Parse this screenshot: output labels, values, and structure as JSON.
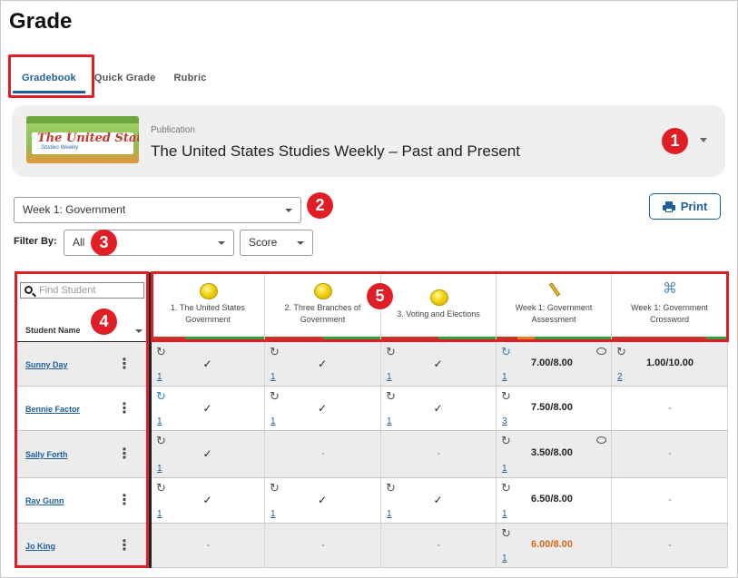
{
  "page": {
    "title": "Grade"
  },
  "tabs": [
    {
      "label": "Gradebook",
      "active": true
    },
    {
      "label": "Quick Grade",
      "active": false
    },
    {
      "label": "Rubric",
      "active": false
    }
  ],
  "publication": {
    "label": "Publication",
    "name": "The United States Studies Weekly – Past and Present",
    "cover_title": "The United States",
    "cover_subtitle": "Studies Weekly"
  },
  "week_select": {
    "value": "Week 1: Government"
  },
  "print_label": "Print",
  "filter": {
    "label": "Filter By:",
    "value": "All",
    "score_value": "Score"
  },
  "search": {
    "placeholder": "Find Student"
  },
  "student_header": "Student Name",
  "badges": [
    "1",
    "2",
    "3",
    "4",
    "5"
  ],
  "columns": [
    {
      "line1": "1. The United States",
      "line2": "Government",
      "icon": "coin-icon"
    },
    {
      "line1": "2. Three Branches of",
      "line2": "Government",
      "icon": "coin-icon"
    },
    {
      "line1": "3. Voting and Elections",
      "line2": "",
      "icon": "coin-icon"
    },
    {
      "line1": "Week 1: Government",
      "line2": "Assessment",
      "icon": "pencil-icon"
    },
    {
      "line1": "Week 1: Government",
      "line2": "Crossword",
      "icon": "crossword-icon"
    }
  ],
  "students": [
    {
      "name": "Sunny Day",
      "cells": [
        {
          "refresh": "gray",
          "mark": "✓",
          "attempt": "1"
        },
        {
          "refresh": "gray",
          "mark": "✓",
          "attempt": "1"
        },
        {
          "refresh": "gray",
          "mark": "✓",
          "attempt": "1"
        },
        {
          "refresh": "blue",
          "score": "7.00/8.00",
          "attempt": "1",
          "comment": true
        },
        {
          "refresh": "gray",
          "score": "1.00/10.00",
          "attempt": "2"
        }
      ]
    },
    {
      "name": "Bennie Factor",
      "cells": [
        {
          "refresh": "blue",
          "mark": "✓",
          "attempt": "1"
        },
        {
          "refresh": "gray",
          "mark": "✓",
          "attempt": "1"
        },
        {
          "refresh": "gray",
          "mark": "✓",
          "attempt": "1"
        },
        {
          "refresh": "gray",
          "score": "7.50/8.00",
          "attempt": "3"
        },
        {
          "dash": "-"
        }
      ]
    },
    {
      "name": "Sally Forth",
      "cells": [
        {
          "refresh": "gray",
          "mark": "✓",
          "attempt": "1"
        },
        {
          "dash": "-"
        },
        {
          "dash": "-"
        },
        {
          "refresh": "gray",
          "score": "3.50/8.00",
          "attempt": "1",
          "comment": true
        },
        {
          "dash": "-"
        }
      ]
    },
    {
      "name": "Ray Gunn",
      "cells": [
        {
          "refresh": "gray",
          "mark": "✓",
          "attempt": "1"
        },
        {
          "refresh": "gray",
          "mark": "✓",
          "attempt": "1"
        },
        {
          "refresh": "gray",
          "mark": "✓",
          "attempt": "1"
        },
        {
          "refresh": "gray",
          "score": "6.50/8.00",
          "attempt": "1"
        },
        {
          "dash": "-"
        }
      ]
    },
    {
      "name": "Jo King",
      "cells": [
        {
          "dash": "-"
        },
        {
          "dash": "-"
        },
        {
          "dash": "-"
        },
        {
          "refresh": "gray",
          "score": "6.00/8.00",
          "attempt": "1",
          "late": true
        },
        {
          "dash": "-"
        }
      ]
    }
  ],
  "colors": {
    "accent": "#1d5e9c",
    "highlight": "#e01e26",
    "late_score": "#d46a1a"
  }
}
